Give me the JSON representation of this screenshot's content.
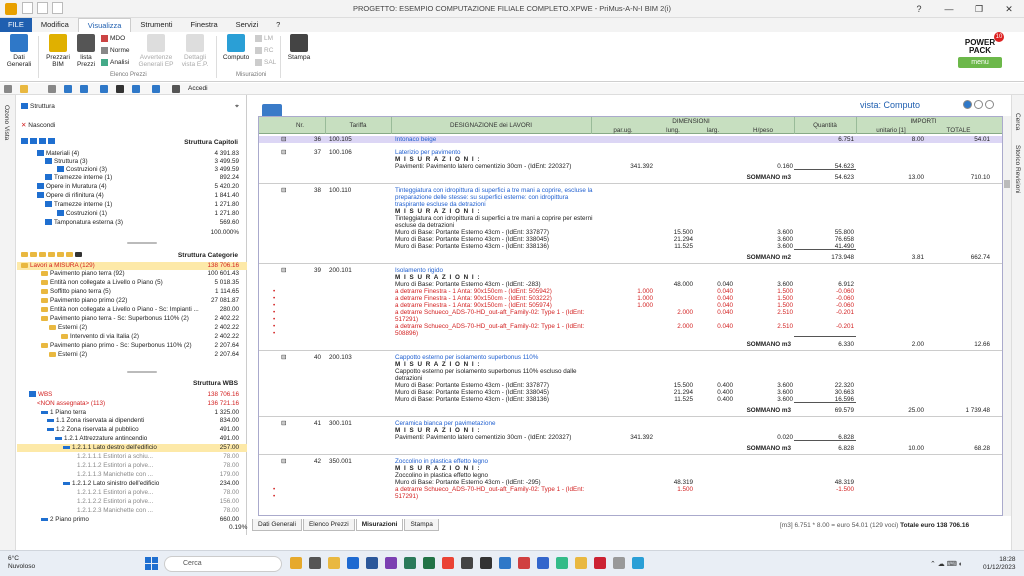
{
  "titlebar": {
    "title": "PROGETTO: ESEMPIO COMPUTAZIONE FILIALE COMPLETO.XPWE - PriMus-A-N-I   BIM 2(i)",
    "controls": [
      "?",
      "—",
      "❐",
      "✕"
    ]
  },
  "ribbon_tabs": [
    "FILE",
    "Modifica",
    "Visualizza",
    "Strumenti",
    "Finestra",
    "Servizi",
    "?"
  ],
  "ribbon": {
    "dati_generali": "Dati Generali",
    "prezzari_bim": "Prezzari BIM",
    "lista_prezzi": "lista Prezzi",
    "mdo": "MDO",
    "norme": "Norme",
    "analisi": "Analisi",
    "avvertenze": "Avvertenze Generali EP",
    "dettagli": "Dettagli vista E.P.",
    "group_elenco": "Elenco Prezzi",
    "computo": "Computo",
    "lm": "LM",
    "rc": "RC",
    "sal": "SAL",
    "group_misurazioni": "Misurazioni",
    "stampa": "Stampa",
    "powerpack": "POWER PACK",
    "powerpack_menu": "menu",
    "powerpack_badge": "10"
  },
  "toolbar": {
    "accedi": "Accedi"
  },
  "left_strip": {
    "label": "Ozono Vista"
  },
  "right_strip": {
    "label1": "Cerca",
    "label2": "Storico Revisioni"
  },
  "left_panel": {
    "header": "Struttura",
    "nascondi": "Nascondi",
    "struttura_capitoli": {
      "title": "Struttura Capitoli",
      "rows": [
        {
          "label": "Materiali (4)",
          "value": "4 391.83"
        },
        {
          "label": "Struttura (3)",
          "value": "3 499.59"
        },
        {
          "label": "Costruzioni (3)",
          "value": "3 499.59"
        },
        {
          "label": "Tramezze interne (1)",
          "value": "892.24"
        },
        {
          "label": "Opere in Muratura (4)",
          "value": "5 420.20"
        },
        {
          "label": "Opere di rifinitura (4)",
          "value": "1 841.40"
        },
        {
          "label": "Tramezze interne (1)",
          "value": "1 271.80"
        },
        {
          "label": "Costruzioni (1)",
          "value": "1 271.80"
        },
        {
          "label": "Tamponatura esterna (3)",
          "value": "569.60"
        }
      ],
      "total": "100.000%"
    },
    "struttura_categorie": {
      "title": "Struttura Categorie",
      "rows": [
        {
          "label": "Lavori a MISURA (129)",
          "value": "138 706.16"
        },
        {
          "label": "Pavimento piano terra (92)",
          "value": "100 601.43"
        },
        {
          "label": "Entità non collegate a Livello o Piano (5)",
          "value": "5 018.35"
        },
        {
          "label": "Soffitto piano terra (5)",
          "value": "1 114.65"
        },
        {
          "label": "Pavimento piano primo (22)",
          "value": "27 081.87"
        },
        {
          "label": "Entità non collegate a Livello o Piano - Sc: Impianti ...",
          "value": "280.00"
        },
        {
          "label": "Pavimento piano terra - Sc: Superbonus 110% (2)",
          "value": "2 402.22"
        },
        {
          "label": "Esterni (2)",
          "value": "2 402.22"
        },
        {
          "label": "Intervento di via Italia (2)",
          "value": "2 402.22"
        },
        {
          "label": "Pavimento piano primo - Sc: Superbonus 110% (2)",
          "value": "2 207.64"
        },
        {
          "label": "Esterni (2)",
          "value": "2 207.64"
        }
      ]
    },
    "struttura_wbs": {
      "title": "Struttura WBS",
      "rows": [
        {
          "label": "WBS",
          "value": "138 706.16"
        },
        {
          "label": "<NON assegnata> (113)",
          "value": "136 721.16"
        },
        {
          "label": "1   Piano terra",
          "value": "1 325.00"
        },
        {
          "label": "1.1   Zona riservata ai dipendenti",
          "value": "834.00"
        },
        {
          "label": "1.2   Zona riservata al pubblico",
          "value": "491.00"
        },
        {
          "label": "1.2.1   Attrezzature antincendio",
          "value": "491.00"
        },
        {
          "label": "1.2.1.1   Lato destro dell'edificio",
          "value": "257.00"
        },
        {
          "label": "1.2.1.1.1   Estintori a schiu...",
          "value": "78.00"
        },
        {
          "label": "1.2.1.1.2   Estintori a polve...",
          "value": "78.00"
        },
        {
          "label": "1.2.1.1.3   Manichette con ...",
          "value": "179.00"
        },
        {
          "label": "1.2.1.2   Lato sinistro dell'edificio",
          "value": "234.00"
        },
        {
          "label": "1.2.1.2.1   Estintori a polve...",
          "value": "78.00"
        },
        {
          "label": "1.2.1.2.2   Estintori a polve...",
          "value": "156.00"
        },
        {
          "label": "1.2.1.2.3   Manichette con ...",
          "value": "78.00"
        },
        {
          "label": "2   Piano primo",
          "value": "660.00"
        }
      ],
      "footer": "0.19%"
    }
  },
  "view": {
    "label": "vista:",
    "name": "Computo"
  },
  "grid": {
    "headers": {
      "n": "Nr.",
      "tariffa": "Tariffa",
      "designazione": "DESIGNAZIONE dei LAVORI",
      "dimensioni": "DIMENSIONI",
      "parug": "par.ug.",
      "lung": "lung.",
      "larg": "larg.",
      "hpeso": "H/peso",
      "quantita": "Quantità",
      "importi": "IMPORTI",
      "unitario": "unitario [1]",
      "totale": "TOTALE"
    },
    "rows": [
      {
        "t": "item",
        "n": "36",
        "code": "100.105",
        "desc": "Intonaco beige",
        "q": "6.751",
        "u": "8.00",
        "tot": "54.01",
        "hi": true
      },
      {
        "t": "item",
        "n": "37",
        "code": "100.106",
        "desc": "Laterizio per pavimento"
      },
      {
        "t": "mis",
        "desc": "M I S U R A Z I O N I :"
      },
      {
        "t": "line",
        "desc": "Pavimenti: Pavimento latero cementizio 30cm - (IdEnt: 220327)",
        "p": "341.392",
        "h": "0.160",
        "q": "54.623"
      },
      {
        "t": "sum",
        "desc": "SOMMANO m3",
        "q": "54.623",
        "u": "13.00",
        "tot": "710.10"
      },
      {
        "t": "item",
        "n": "38",
        "code": "100.110",
        "desc": "Tinteggiatura con idropittura di superfici a tre mani a coprire, escluse la"
      },
      {
        "t": "blue",
        "desc": "preparazione delle stesse: su superfici esterne: con idropittura"
      },
      {
        "t": "blue",
        "desc": "traspirante escluse da detrazioni"
      },
      {
        "t": "mis",
        "desc": "M I S U R A Z I O N I :"
      },
      {
        "t": "line",
        "desc": "Tinteggiatura con idropittura di superfici a tre mani a coprire per esterni"
      },
      {
        "t": "line",
        "desc": "escluse da detrazioni"
      },
      {
        "t": "line",
        "desc": "Muro di Base: Portante Esterno 43cm - (IdEnt: 337877)",
        "l": "15.500",
        "h": "3.600",
        "q": "55.800"
      },
      {
        "t": "line",
        "desc": "Muro di Base: Portante Esterno 43cm - (IdEnt: 338045)",
        "l": "21.294",
        "h": "3.600",
        "q": "76.658"
      },
      {
        "t": "line",
        "desc": "Muro di Base: Portante Esterno 43cm - (IdEnt: 338136)",
        "l": "11.525",
        "h": "3.600",
        "q": "41.490"
      },
      {
        "t": "sum",
        "desc": "SOMMANO m2",
        "q": "173.948",
        "u": "3.81",
        "tot": "662.74"
      },
      {
        "t": "item",
        "n": "39",
        "code": "200.101",
        "desc": "Isolamento rigido"
      },
      {
        "t": "mis",
        "desc": "M I S U R A Z I O N I :"
      },
      {
        "t": "line",
        "desc": "Muro di Base: Portante Esterno 43cm - (IdEnt: -283)",
        "l": "48.000",
        "w": "0.040",
        "h": "3.600",
        "q": "6.912"
      },
      {
        "t": "red",
        "desc": "a detrarre Finestra - 1 Anta: 90x150cm - (IdEnt: 505942)",
        "p": "1.000",
        "w": "0.040",
        "h": "1.500",
        "q": "-0.060"
      },
      {
        "t": "red",
        "desc": "a detrarre Finestra - 1 Anta: 90x150cm - (IdEnt: 503222)",
        "p": "1.000",
        "w": "0.040",
        "h": "1.500",
        "q": "-0.060"
      },
      {
        "t": "red",
        "desc": "a detrarre Finestra - 1 Anta: 90x150cm - (IdEnt: 505974)",
        "p": "1.000",
        "w": "0.040",
        "h": "1.500",
        "q": "-0.060"
      },
      {
        "t": "red",
        "desc": "a detrarre Schueco_ADS-70-HD_out-aft_Family-02: Type 1 - (IdEnt:",
        "l": "2.000",
        "w": "0.040",
        "h": "2.510",
        "q": "-0.201"
      },
      {
        "t": "red",
        "desc": "517291)"
      },
      {
        "t": "red",
        "desc": "a detrarre Schueco_ADS-70-HD_out-aft_Family-02: Type 1 - (IdEnt:",
        "l": "2.000",
        "w": "0.040",
        "h": "2.510",
        "q": "-0.201"
      },
      {
        "t": "red",
        "desc": "508896)"
      },
      {
        "t": "sum",
        "desc": "SOMMANO m3",
        "q": "6.330",
        "u": "2.00",
        "tot": "12.66"
      },
      {
        "t": "item",
        "n": "40",
        "code": "200.103",
        "desc": "Cappotto esterno per isolamento superbonus 110%"
      },
      {
        "t": "mis",
        "desc": "M I S U R A Z I O N I :"
      },
      {
        "t": "line",
        "desc": "Cappotto esterno per isolamento superbonus 110% escluso dalle"
      },
      {
        "t": "line",
        "desc": "detrazioni"
      },
      {
        "t": "line",
        "desc": "Muro di Base: Portante Esterno 43cm - (IdEnt: 337877)",
        "l": "15.500",
        "w": "0.400",
        "h": "3.600",
        "q": "22.320"
      },
      {
        "t": "line",
        "desc": "Muro di Base: Portante Esterno 43cm - (IdEnt: 338045)",
        "l": "21.294",
        "w": "0.400",
        "h": "3.600",
        "q": "30.663"
      },
      {
        "t": "line",
        "desc": "Muro di Base: Portante Esterno 43cm - (IdEnt: 338136)",
        "l": "11.525",
        "w": "0.400",
        "h": "3.600",
        "q": "16.596"
      },
      {
        "t": "sum",
        "desc": "SOMMANO m3",
        "q": "69.579",
        "u": "25.00",
        "tot": "1 739.48"
      },
      {
        "t": "item",
        "n": "41",
        "code": "300.101",
        "desc": "Ceramica bianca per pavimetazione"
      },
      {
        "t": "mis",
        "desc": "M I S U R A Z I O N I :"
      },
      {
        "t": "line",
        "desc": "Pavimenti: Pavimento latero cementizio 30cm - (IdEnt: 220327)",
        "p": "341.392",
        "h": "0.020",
        "q": "6.828"
      },
      {
        "t": "sum",
        "desc": "SOMMANO m3",
        "q": "6.828",
        "u": "10.00",
        "tot": "68.28"
      },
      {
        "t": "item",
        "n": "42",
        "code": "350.001",
        "desc": "Zoccolino in plastica effetto legno"
      },
      {
        "t": "mis",
        "desc": "M I S U R A Z I O N I :"
      },
      {
        "t": "line",
        "desc": "Zoccolino in plastica effetto legno"
      },
      {
        "t": "line",
        "desc": "Muro di Base: Portante Esterno 43cm - (IdEnt: -295)",
        "l": "48.319",
        "q": "48.319"
      },
      {
        "t": "red",
        "desc": "a detrarre Schueco_ADS-70-HD_out-aft_Family-02: Type 1 - (IdEnt:",
        "l": "1.500",
        "q": "-1.500"
      },
      {
        "t": "red",
        "desc": "517291)"
      }
    ]
  },
  "bottom_tabs": [
    "Dati Generali",
    "Elenco Prezzi",
    "Misurazioni",
    "Stampa"
  ],
  "status": {
    "calc": "[m3] 6.751 * 8.00 = euro 54.01",
    "voci": "(129 voci)",
    "totale_label": "Totale",
    "totale": "euro   138 706.16"
  },
  "taskbar": {
    "temp": "6°C",
    "weather": "Nuvoloso",
    "search": "Cerca",
    "time": "18:28",
    "date": "01/12/2023"
  }
}
